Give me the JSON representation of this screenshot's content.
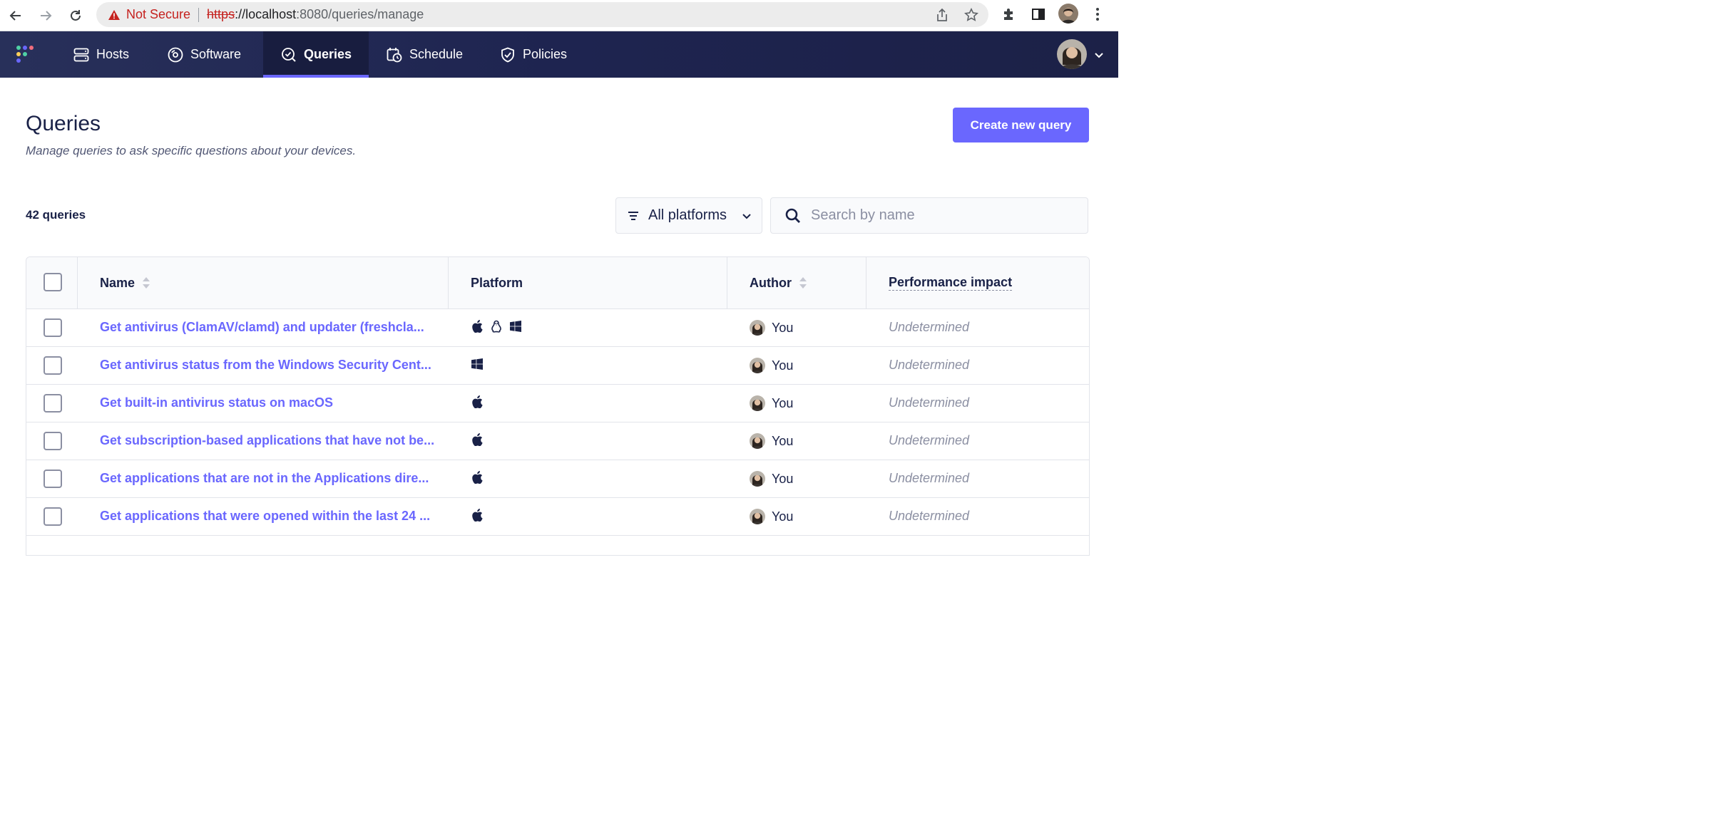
{
  "browser": {
    "security_label": "Not Secure",
    "url_scheme": "https",
    "url_rest_host": "://localhost",
    "url_rest_path": ":8080/queries/manage"
  },
  "nav": {
    "items": [
      {
        "label": "Hosts",
        "icon": "hosts-icon"
      },
      {
        "label": "Software",
        "icon": "software-icon"
      },
      {
        "label": "Queries",
        "icon": "queries-icon",
        "active": true
      },
      {
        "label": "Schedule",
        "icon": "schedule-icon"
      },
      {
        "label": "Policies",
        "icon": "policies-icon"
      }
    ]
  },
  "page": {
    "title": "Queries",
    "subtitle": "Manage queries to ask specific questions about your devices.",
    "create_button": "Create new query",
    "count": "42 queries",
    "platform_filter": "All platforms",
    "search_placeholder": "Search by name"
  },
  "table": {
    "headers": {
      "name": "Name",
      "platform": "Platform",
      "author": "Author",
      "performance": "Performance impact"
    },
    "rows": [
      {
        "name": "Get antivirus (ClamAV/clamd) and updater (freshcla...",
        "platforms": [
          "apple-icon",
          "linux-icon",
          "windows-icon"
        ],
        "author": "You",
        "performance": "Undetermined"
      },
      {
        "name": "Get antivirus status from the Windows Security Cent...",
        "platforms": [
          "windows-icon"
        ],
        "author": "You",
        "performance": "Undetermined"
      },
      {
        "name": "Get built-in antivirus status on macOS",
        "platforms": [
          "apple-icon"
        ],
        "author": "You",
        "performance": "Undetermined"
      },
      {
        "name": "Get subscription-based applications that have not be...",
        "platforms": [
          "apple-icon"
        ],
        "author": "You",
        "performance": "Undetermined"
      },
      {
        "name": "Get applications that are not in the Applications dire...",
        "platforms": [
          "apple-icon"
        ],
        "author": "You",
        "performance": "Undetermined"
      },
      {
        "name": "Get applications that were opened within the last 24 ...",
        "platforms": [
          "apple-icon"
        ],
        "author": "You",
        "performance": "Undetermined"
      }
    ]
  },
  "colors": {
    "accent": "#6a67fe",
    "nav_bg": "#1e2450",
    "text": "#192147",
    "muted": "#8b8fa2"
  }
}
